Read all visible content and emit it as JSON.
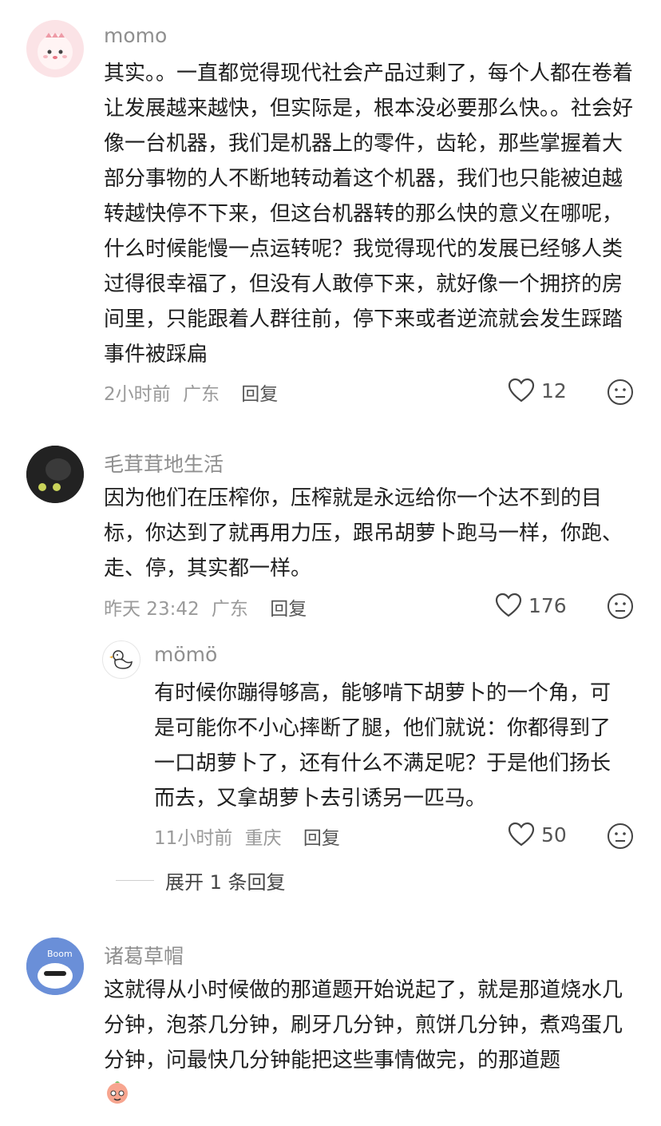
{
  "comments": [
    {
      "username": "momo",
      "text": "其实。。一直都觉得现代社会产品过剩了，每个人都在卷着让发展越来越快，但实际是，根本没必要那么快。。社会好像一台机器，我们是机器上的零件，齿轮，那些掌握着大部分事物的人不断地转动着这个机器，我们也只能被迫越转越快停不下来，但这台机器转的那么快的意义在哪呢，什么时候能慢一点运转呢？我觉得现代的发展已经够人类过得很幸福了，但没有人敢停下来，就好像一个拥挤的房间里，只能跟着人群往前，停下来或者逆流就会发生踩踏事件被踩扁",
      "time": "2小时前",
      "location": "广东",
      "reply_label": "回复",
      "likes": "12"
    },
    {
      "username": "毛茸茸地生活",
      "text": "因为他们在压榨你，压榨就是永远给你一个达不到的目标，你达到了就再用力压，跟吊胡萝卜跑马一样，你跑、走、停，其实都一样。",
      "time": "昨天 23:42",
      "location": "广东",
      "reply_label": "回复",
      "likes": "176",
      "replies": [
        {
          "username": "mömö",
          "text": "有时候你蹦得够高，能够啃下胡萝卜的一个角，可是可能你不小心摔断了腿，他们就说：你都得到了一口胡萝卜了，还有什么不满足呢？于是他们扬长而去，又拿胡萝卜去引诱另一匹马。",
          "time": "11小时前",
          "location": "重庆",
          "reply_label": "回复",
          "likes": "50"
        }
      ],
      "expand_label": "展开 1 条回复"
    },
    {
      "username": "诸葛草帽",
      "text": "这就得从小时候做的那道题开始说起了，就是那道烧水几分钟，泡茶几分钟，刷牙几分钟，煎饼几分钟，煮鸡蛋几分钟，问最快几分钟能把这些事情做完，的那道题",
      "avatar_text": "Boom"
    }
  ],
  "colors": {
    "text": "#1f1f1f",
    "username": "#8f8f8f",
    "meta": "#9a9a9a"
  }
}
